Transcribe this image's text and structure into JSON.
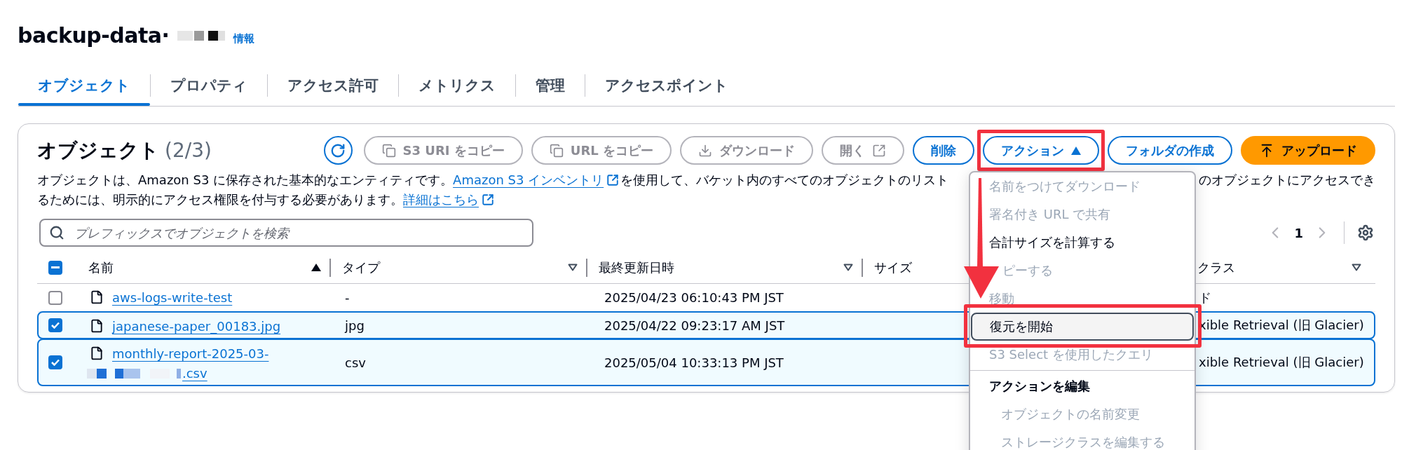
{
  "header": {
    "title": "backup-data·",
    "redacted": true,
    "info_link": "情報"
  },
  "tabs": [
    {
      "label": "オブジェクト",
      "selected": true
    },
    {
      "label": "プロパティ",
      "selected": false
    },
    {
      "label": "アクセス許可",
      "selected": false
    },
    {
      "label": "メトリクス",
      "selected": false
    },
    {
      "label": "管理",
      "selected": false
    },
    {
      "label": "アクセスポイント",
      "selected": false
    }
  ],
  "objects_panel": {
    "title": "オブジェクト",
    "count": "(2/3)",
    "toolbar": [
      {
        "kind": "refresh",
        "disabled": false
      },
      {
        "kind": "copy",
        "label": "S3 URI をコピー",
        "disabled": true
      },
      {
        "kind": "copy",
        "label": "URL をコピー",
        "disabled": true
      },
      {
        "kind": "download",
        "label": "ダウンロード",
        "disabled": true
      },
      {
        "kind": "open",
        "label": "開く",
        "disabled": true
      },
      {
        "kind": "plain",
        "label": "削除",
        "disabled": false
      },
      {
        "kind": "dropdown",
        "label": "アクション",
        "disabled": false,
        "annotated": true
      },
      {
        "kind": "plain",
        "label": "フォルダの作成",
        "disabled": false
      },
      {
        "kind": "upload",
        "label": "アップロード"
      }
    ],
    "description": {
      "line_1": [
        {
          "kind": "text",
          "text": "オブジェクトは、Amazon S3 に保存された基本的なエンティティです。"
        },
        {
          "kind": "link",
          "text": "Amazon S3 インベントリ",
          "external": true
        },
        {
          "kind": "text",
          "text": "を使用して、バケット内のすべてのオブジェクトのリスト"
        },
        {
          "kind": "gap"
        },
        {
          "kind": "text",
          "text": "のオブジェクトにアクセスでき"
        }
      ],
      "line_2": [
        {
          "kind": "text",
          "text": "るためには、明示的にアクセス権限を付与する必要があります。"
        },
        {
          "kind": "link",
          "text": "詳細はこちら",
          "external": true
        }
      ]
    },
    "search": {
      "placeholder": "プレフィックスでオブジェクトを検索"
    },
    "pagination": {
      "page": "1",
      "prev_disabled": true,
      "next_disabled": true
    },
    "table": {
      "select_all": {
        "checked": true,
        "indeterminate": true
      },
      "columns": [
        {
          "label": "名前",
          "sorted": true
        },
        {
          "label": "タイプ",
          "sorted": false
        },
        {
          "label": "最終更新日時",
          "sorted": false
        },
        {
          "label": "サイズ"
        },
        {
          "label": "クラス",
          "sorted": false
        }
      ],
      "rows": [
        {
          "selected": false,
          "name": "aws-logs-write-test",
          "type": "-",
          "last_modified": "2025/04/23 06:10:43 PM JST",
          "storage_class": "ド"
        },
        {
          "selected": true,
          "name": "japanese-paper_00183.jpg",
          "type": "jpg",
          "last_modified": "2025/04/22 09:23:17 AM JST",
          "storage_class": "xible Retrieval (旧 Glacier)"
        },
        {
          "selected": true,
          "name": "monthly-report-2025-03-",
          "name_end": ".csv",
          "redacted": true,
          "type": "csv",
          "last_modified": "2025/05/04 10:33:13 PM JST",
          "storage_class": "xible Retrieval (旧 Glacier)"
        }
      ]
    }
  },
  "actions_menu": {
    "items": [
      {
        "kind": "item",
        "label": "名前をつけてダウンロード",
        "disabled": true
      },
      {
        "kind": "item",
        "label": "署名付き URL で共有",
        "disabled": true
      },
      {
        "kind": "item",
        "label": "合計サイズを計算する",
        "disabled": false
      },
      {
        "kind": "item",
        "label": "ピーする",
        "disabled": true,
        "partly_hidden": true
      },
      {
        "kind": "item",
        "label": "移動",
        "disabled": true
      },
      {
        "kind": "item",
        "label": "復元を開始",
        "disabled": false,
        "hovered": true,
        "annotated": true
      },
      {
        "kind": "item",
        "label": "S3 Select を使用したクエリ",
        "disabled": true
      },
      {
        "kind": "divider"
      },
      {
        "kind": "header",
        "label": "アクションを編集"
      },
      {
        "kind": "subitem",
        "label": "オブジェクトの名前変更",
        "disabled": true
      },
      {
        "kind": "subitem",
        "label": "ストレージクラスを編集する",
        "disabled": true
      }
    ]
  },
  "annotation": {
    "kind": "arrow"
  }
}
